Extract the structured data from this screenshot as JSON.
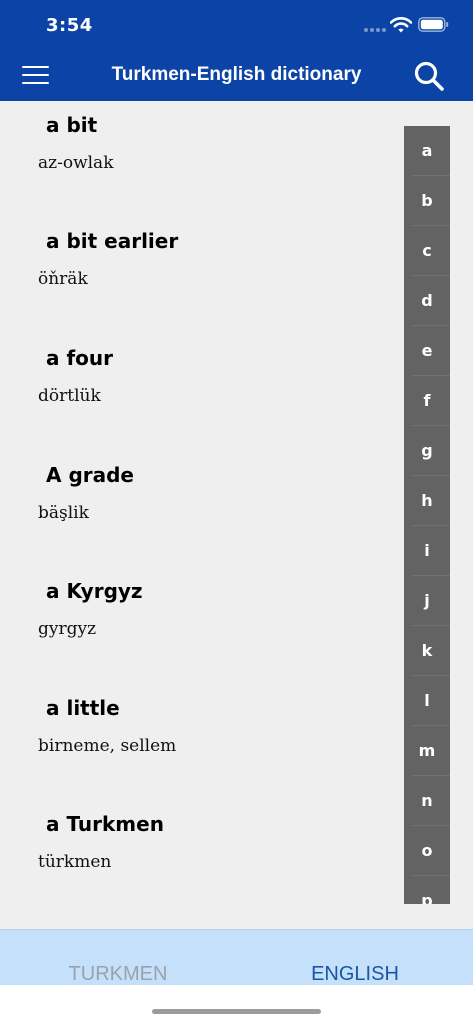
{
  "status_bar": {
    "time": "3:54"
  },
  "header": {
    "title": "Turkmen-English dictionary"
  },
  "icons": {
    "menu": "hamburger-menu-icon",
    "search": "search-icon",
    "wifi": "wifi-icon",
    "battery": "battery-icon"
  },
  "colors": {
    "header_bg": "#0b44a6",
    "list_bg": "#efefef",
    "index_bg": "#636363",
    "tab_bar_bg": "#c5e0fa",
    "tab_active": "#1a56a8",
    "tab_inactive": "#9aa3ad"
  },
  "entries": [
    {
      "word": "a bit",
      "translation": "az-owlak"
    },
    {
      "word": "a bit earlier",
      "translation": "öňräk"
    },
    {
      "word": "a four",
      "translation": "dörtlük"
    },
    {
      "word": "A grade",
      "translation": "bäşlik"
    },
    {
      "word": "a Kyrgyz",
      "translation": "gyrgyz"
    },
    {
      "word": "a little",
      "translation": "birneme, sellem"
    },
    {
      "word": "a Turkmen",
      "translation": "türkmen"
    }
  ],
  "alphabet_index": [
    "a",
    "b",
    "c",
    "d",
    "e",
    "f",
    "g",
    "h",
    "i",
    "j",
    "k",
    "l",
    "m",
    "n",
    "o",
    "p"
  ],
  "tabs": [
    {
      "label": "TURKMEN",
      "active": false
    },
    {
      "label": "ENGLISH",
      "active": true
    }
  ]
}
